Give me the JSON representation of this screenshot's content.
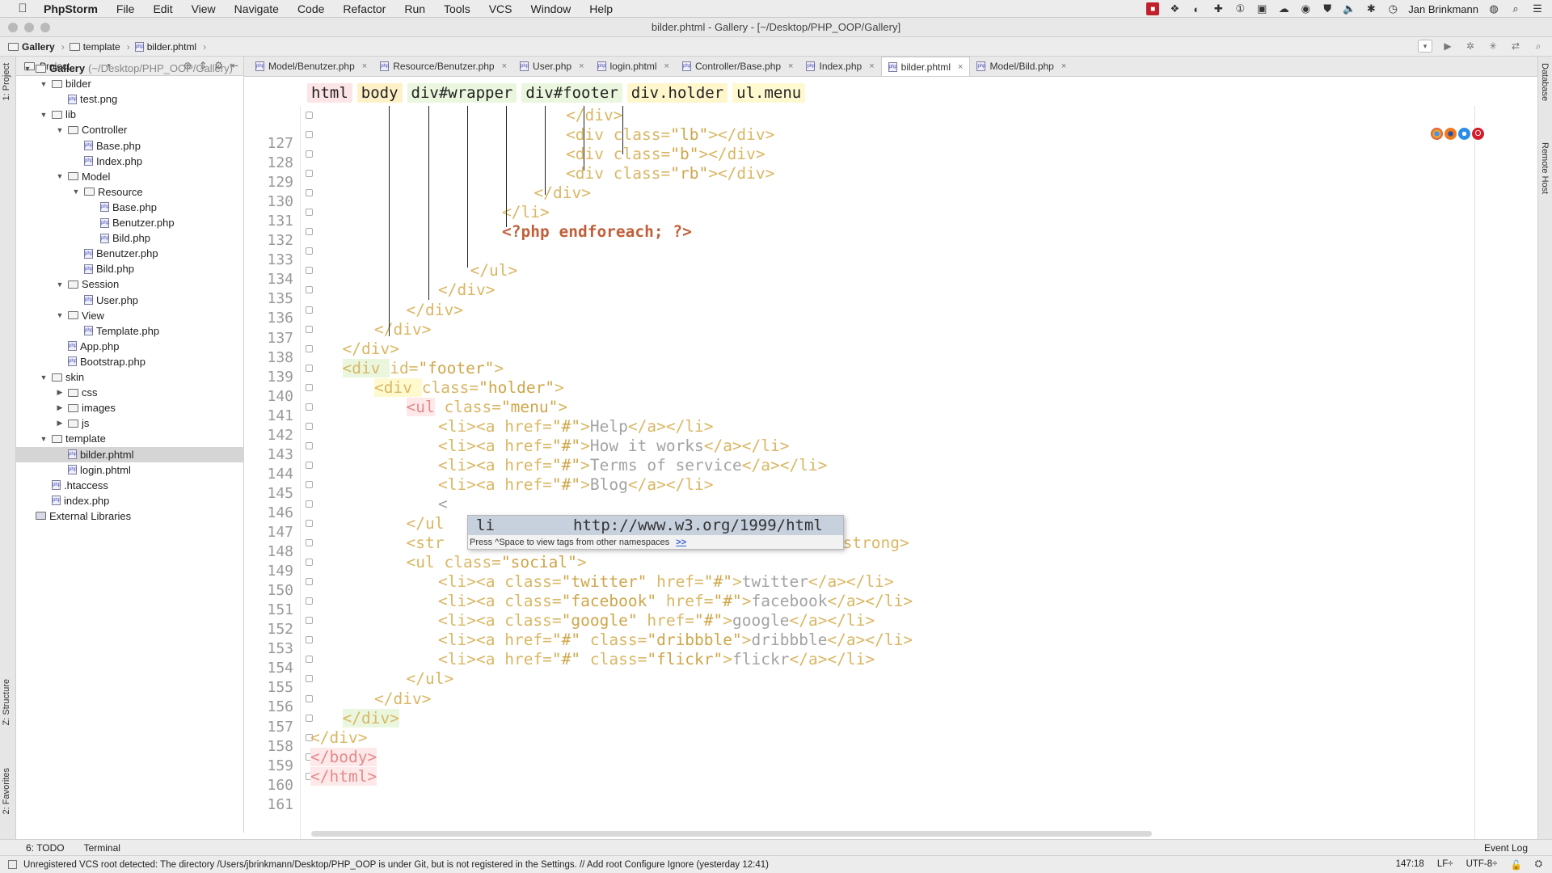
{
  "menubar": {
    "app_name": "PhpStorm",
    "items": [
      "File",
      "Edit",
      "View",
      "Navigate",
      "Code",
      "Refactor",
      "Run",
      "Tools",
      "VCS",
      "Window",
      "Help"
    ],
    "user": "Jan Brinkmann"
  },
  "window": {
    "title": "bilder.phtml - Gallery - [~/Desktop/PHP_OOP/Gallery]"
  },
  "navbar": {
    "crumbs": [
      "Gallery",
      "template",
      "bilder.phtml"
    ]
  },
  "left_strip": {
    "project_label": "1: Project",
    "structure_label": "Z: Structure",
    "favorites_label": "2: Favorites"
  },
  "right_strip": {
    "database_label": "Database",
    "remote_label": "Remote Host"
  },
  "project": {
    "header_label": "Project",
    "tree": [
      {
        "label": "Gallery",
        "suffix": "(~/Desktop/PHP_OOP/Gallery)",
        "depth": 0,
        "type": "folder",
        "open": true
      },
      {
        "label": "bilder",
        "depth": 1,
        "type": "folder",
        "open": true
      },
      {
        "label": "test.png",
        "depth": 2,
        "type": "file"
      },
      {
        "label": "lib",
        "depth": 1,
        "type": "folder",
        "open": true
      },
      {
        "label": "Controller",
        "depth": 2,
        "type": "folder",
        "open": true
      },
      {
        "label": "Base.php",
        "depth": 3,
        "type": "file"
      },
      {
        "label": "Index.php",
        "depth": 3,
        "type": "file"
      },
      {
        "label": "Model",
        "depth": 2,
        "type": "folder",
        "open": true
      },
      {
        "label": "Resource",
        "depth": 3,
        "type": "folder",
        "open": true
      },
      {
        "label": "Base.php",
        "depth": 4,
        "type": "file"
      },
      {
        "label": "Benutzer.php",
        "depth": 4,
        "type": "file"
      },
      {
        "label": "Bild.php",
        "depth": 4,
        "type": "file"
      },
      {
        "label": "Benutzer.php",
        "depth": 3,
        "type": "file"
      },
      {
        "label": "Bild.php",
        "depth": 3,
        "type": "file"
      },
      {
        "label": "Session",
        "depth": 2,
        "type": "folder",
        "open": true
      },
      {
        "label": "User.php",
        "depth": 3,
        "type": "file"
      },
      {
        "label": "View",
        "depth": 2,
        "type": "folder",
        "open": true
      },
      {
        "label": "Template.php",
        "depth": 3,
        "type": "file"
      },
      {
        "label": "App.php",
        "depth": 2,
        "type": "file"
      },
      {
        "label": "Bootstrap.php",
        "depth": 2,
        "type": "file"
      },
      {
        "label": "skin",
        "depth": 1,
        "type": "folder",
        "open": true
      },
      {
        "label": "css",
        "depth": 2,
        "type": "folder",
        "open": false
      },
      {
        "label": "images",
        "depth": 2,
        "type": "folder",
        "open": false
      },
      {
        "label": "js",
        "depth": 2,
        "type": "folder",
        "open": false
      },
      {
        "label": "template",
        "depth": 1,
        "type": "folder",
        "open": true
      },
      {
        "label": "bilder.phtml",
        "depth": 2,
        "type": "file",
        "selected": true
      },
      {
        "label": "login.phtml",
        "depth": 2,
        "type": "file"
      },
      {
        "label": ".htaccess",
        "depth": 1,
        "type": "file"
      },
      {
        "label": "index.php",
        "depth": 1,
        "type": "file"
      },
      {
        "label": "External Libraries",
        "depth": 0,
        "type": "lib"
      }
    ]
  },
  "tabs": [
    {
      "label": "Model/Benutzer.php",
      "active": false
    },
    {
      "label": "Resource/Benutzer.php",
      "active": false
    },
    {
      "label": "User.php",
      "active": false
    },
    {
      "label": "login.phtml",
      "active": false
    },
    {
      "label": "Controller/Base.php",
      "active": false
    },
    {
      "label": "Index.php",
      "active": false
    },
    {
      "label": "bilder.phtml",
      "active": true
    },
    {
      "label": "Model/Bild.php",
      "active": false
    }
  ],
  "tag_breadcrumbs": [
    {
      "label": "html",
      "color": "#fde4e6"
    },
    {
      "label": "body",
      "color": "#fff1c7"
    },
    {
      "label": "div#wrapper",
      "color": "#eaf7de"
    },
    {
      "label": "div#footer",
      "color": "#eaf7de"
    },
    {
      "label": "div.holder",
      "color": "#fff6cc"
    },
    {
      "label": "ul.menu",
      "color": "#fff9d0"
    }
  ],
  "code_lines": [
    {
      "n": 127,
      "indent": 16,
      "parts": [
        [
          "tag",
          "</div>"
        ]
      ]
    },
    {
      "n": 128,
      "indent": 16,
      "parts": [
        [
          "tag",
          "<div "
        ],
        [
          "attr",
          "class="
        ],
        [
          "val",
          "\"lb\""
        ],
        [
          "tag",
          "></div>"
        ]
      ]
    },
    {
      "n": 129,
      "indent": 16,
      "parts": [
        [
          "tag",
          "<div "
        ],
        [
          "attr",
          "class="
        ],
        [
          "val",
          "\"b\""
        ],
        [
          "tag",
          "></div>"
        ]
      ]
    },
    {
      "n": 130,
      "indent": 16,
      "parts": [
        [
          "tag",
          "<div "
        ],
        [
          "attr",
          "class="
        ],
        [
          "val",
          "\"rb\""
        ],
        [
          "tag",
          "></div>"
        ]
      ]
    },
    {
      "n": 131,
      "indent": 14,
      "parts": [
        [
          "tag",
          "</div>"
        ]
      ]
    },
    {
      "n": 132,
      "indent": 12,
      "parts": [
        [
          "tag",
          "</li>"
        ]
      ]
    },
    {
      "n": 133,
      "indent": 12,
      "parts": [
        [
          "php",
          "<?php endforeach; ?>"
        ]
      ]
    },
    {
      "n": 134,
      "indent": 0,
      "parts": []
    },
    {
      "n": 135,
      "indent": 10,
      "parts": [
        [
          "tag",
          "</ul>"
        ]
      ]
    },
    {
      "n": 136,
      "indent": 8,
      "parts": [
        [
          "tag",
          "</div>"
        ]
      ]
    },
    {
      "n": 137,
      "indent": 6,
      "parts": [
        [
          "tag",
          "</div>"
        ]
      ]
    },
    {
      "n": 138,
      "indent": 4,
      "parts": [
        [
          "tag",
          "</div>"
        ]
      ]
    },
    {
      "n": 139,
      "indent": 2,
      "parts": [
        [
          "tag",
          "</div>"
        ]
      ]
    },
    {
      "n": 140,
      "indent": 2,
      "parts": [
        [
          "hlg",
          "<div "
        ],
        [
          "attr",
          "id="
        ],
        [
          "val",
          "\"footer\""
        ],
        [
          "tag",
          ">"
        ]
      ]
    },
    {
      "n": 141,
      "indent": 4,
      "parts": [
        [
          "hly",
          "<div "
        ],
        [
          "attr",
          "class="
        ],
        [
          "val",
          "\"holder\""
        ],
        [
          "tag",
          ">"
        ]
      ]
    },
    {
      "n": 142,
      "indent": 6,
      "parts": [
        [
          "hlr",
          "<ul"
        ],
        [
          "attr",
          " class="
        ],
        [
          "val",
          "\"menu\""
        ],
        [
          "tag",
          ">"
        ]
      ]
    },
    {
      "n": 143,
      "indent": 8,
      "parts": [
        [
          "tag",
          "<li><a "
        ],
        [
          "attr",
          "href="
        ],
        [
          "val",
          "\"#\""
        ],
        [
          "tag",
          ">"
        ],
        [
          "text",
          "Help"
        ],
        [
          "tag",
          "</a></li>"
        ]
      ]
    },
    {
      "n": 144,
      "indent": 8,
      "parts": [
        [
          "tag",
          "<li><a "
        ],
        [
          "attr",
          "href="
        ],
        [
          "val",
          "\"#\""
        ],
        [
          "tag",
          ">"
        ],
        [
          "text",
          "How it works"
        ],
        [
          "tag",
          "</a></li>"
        ]
      ]
    },
    {
      "n": 145,
      "indent": 8,
      "parts": [
        [
          "tag",
          "<li><a "
        ],
        [
          "attr",
          "href="
        ],
        [
          "val",
          "\"#\""
        ],
        [
          "tag",
          ">"
        ],
        [
          "text",
          "Terms of service"
        ],
        [
          "tag",
          "</a></li>"
        ]
      ]
    },
    {
      "n": 146,
      "indent": 8,
      "parts": [
        [
          "tag",
          "<li><a "
        ],
        [
          "attr",
          "href="
        ],
        [
          "val",
          "\"#\""
        ],
        [
          "tag",
          ">"
        ],
        [
          "text",
          "Blog"
        ],
        [
          "tag",
          "</a></li>"
        ]
      ]
    },
    {
      "n": 147,
      "indent": 8,
      "parts": [
        [
          "text",
          "<"
        ]
      ]
    },
    {
      "n": 148,
      "indent": 6,
      "parts": [
        [
          "tag",
          "</ul"
        ]
      ]
    },
    {
      "n": 149,
      "indent": 6,
      "parts": [
        [
          "tag",
          "<str"
        ],
        [
          "text",
          "                                    "
        ],
        [
          "tag",
          "</a></strong>"
        ]
      ]
    },
    {
      "n": 150,
      "indent": 6,
      "parts": [
        [
          "tag",
          "<ul "
        ],
        [
          "attr",
          "class="
        ],
        [
          "val",
          "\"social\""
        ],
        [
          "tag",
          ">"
        ]
      ]
    },
    {
      "n": 151,
      "indent": 8,
      "parts": [
        [
          "tag",
          "<li><a "
        ],
        [
          "attr",
          "class="
        ],
        [
          "val",
          "\"twitter\""
        ],
        [
          "attr",
          " href="
        ],
        [
          "val",
          "\"#\""
        ],
        [
          "tag",
          ">"
        ],
        [
          "text",
          "twitter"
        ],
        [
          "tag",
          "</a></li>"
        ]
      ]
    },
    {
      "n": 152,
      "indent": 8,
      "parts": [
        [
          "tag",
          "<li><a "
        ],
        [
          "attr",
          "class="
        ],
        [
          "val",
          "\"facebook\""
        ],
        [
          "attr",
          " href="
        ],
        [
          "val",
          "\"#\""
        ],
        [
          "tag",
          ">"
        ],
        [
          "text",
          "facebook"
        ],
        [
          "tag",
          "</a></li>"
        ]
      ]
    },
    {
      "n": 153,
      "indent": 8,
      "parts": [
        [
          "tag",
          "<li><a "
        ],
        [
          "attr",
          "class="
        ],
        [
          "val",
          "\"google\""
        ],
        [
          "attr",
          " href="
        ],
        [
          "val",
          "\"#\""
        ],
        [
          "tag",
          ">"
        ],
        [
          "text",
          "google"
        ],
        [
          "tag",
          "</a></li>"
        ]
      ]
    },
    {
      "n": 154,
      "indent": 8,
      "parts": [
        [
          "tag",
          "<li><a "
        ],
        [
          "attr",
          "href="
        ],
        [
          "val",
          "\"#\""
        ],
        [
          "attr",
          " class="
        ],
        [
          "val",
          "\"dribbble\""
        ],
        [
          "tag",
          ">"
        ],
        [
          "text",
          "dribbble"
        ],
        [
          "tag",
          "</a></li>"
        ]
      ]
    },
    {
      "n": 155,
      "indent": 8,
      "parts": [
        [
          "tag",
          "<li><a "
        ],
        [
          "attr",
          "href="
        ],
        [
          "val",
          "\"#\""
        ],
        [
          "attr",
          " class="
        ],
        [
          "val",
          "\"flickr\""
        ],
        [
          "tag",
          ">"
        ],
        [
          "text",
          "flickr"
        ],
        [
          "tag",
          "</a></li>"
        ]
      ]
    },
    {
      "n": 156,
      "indent": 6,
      "parts": [
        [
          "tag",
          "</ul>"
        ]
      ]
    },
    {
      "n": 157,
      "indent": 4,
      "parts": [
        [
          "tag",
          "</div>"
        ]
      ]
    },
    {
      "n": 158,
      "indent": 2,
      "parts": [
        [
          "hlg",
          "</div>"
        ]
      ]
    },
    {
      "n": 159,
      "indent": 0,
      "parts": [
        [
          "tag",
          "</div>"
        ]
      ]
    },
    {
      "n": 160,
      "indent": 0,
      "parts": [
        [
          "hlr",
          "</body>"
        ]
      ]
    },
    {
      "n": 161,
      "indent": 0,
      "parts": [
        [
          "hlr",
          "</html>"
        ]
      ]
    }
  ],
  "autocomplete": {
    "item_name": "li",
    "item_ns": "http://www.w3.org/1999/html",
    "hint": "Press ^Space to view tags from other namespaces",
    "hint_link": ">>"
  },
  "bottom_tools": {
    "todo": "6: TODO",
    "terminal": "Terminal",
    "event_log": "Event Log"
  },
  "status": {
    "message": "Unregistered VCS root detected: The directory /Users/jbrinkmann/Desktop/PHP_OOP is under Git, but is not registered in the Settings. // Add root  Configure  Ignore (yesterday 12:41)",
    "position": "147:18",
    "line_sep": "LF÷",
    "encoding": "UTF-8÷"
  }
}
